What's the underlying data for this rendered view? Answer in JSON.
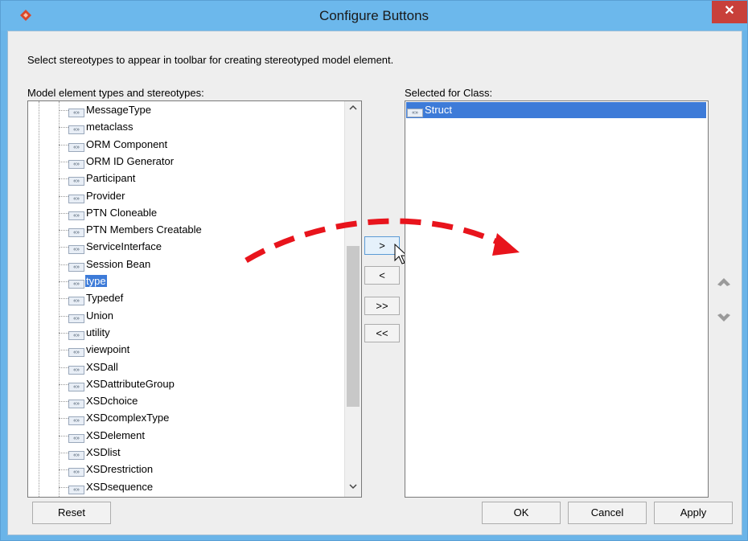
{
  "window": {
    "title": "Configure Buttons",
    "close_symbol": "✕"
  },
  "instructions": "Select stereotypes to appear in toolbar for creating stereotyped model element.",
  "left_panel": {
    "label": "Model element types and stereotypes:",
    "icon_text": "«»",
    "items": [
      {
        "label": "MessageType",
        "selected": false
      },
      {
        "label": "metaclass",
        "selected": false
      },
      {
        "label": "ORM Component",
        "selected": false
      },
      {
        "label": "ORM ID Generator",
        "selected": false
      },
      {
        "label": "Participant",
        "selected": false
      },
      {
        "label": "Provider",
        "selected": false
      },
      {
        "label": "PTN Cloneable",
        "selected": false
      },
      {
        "label": "PTN Members Creatable",
        "selected": false
      },
      {
        "label": "ServiceInterface",
        "selected": false
      },
      {
        "label": "Session Bean",
        "selected": false
      },
      {
        "label": "type",
        "selected": true
      },
      {
        "label": "Typedef",
        "selected": false
      },
      {
        "label": "Union",
        "selected": false
      },
      {
        "label": "utility",
        "selected": false
      },
      {
        "label": "viewpoint",
        "selected": false
      },
      {
        "label": "XSDall",
        "selected": false
      },
      {
        "label": "XSDattributeGroup",
        "selected": false
      },
      {
        "label": "XSDchoice",
        "selected": false
      },
      {
        "label": "XSDcomplexType",
        "selected": false
      },
      {
        "label": "XSDelement",
        "selected": false
      },
      {
        "label": "XSDlist",
        "selected": false
      },
      {
        "label": "XSDrestriction",
        "selected": false
      },
      {
        "label": "XSDsequence",
        "selected": false
      }
    ],
    "scroll_up": "^",
    "scroll_down": "v"
  },
  "middle_buttons": {
    "add": ">",
    "remove": "<",
    "add_all": ">>",
    "remove_all": "<<"
  },
  "right_panel": {
    "label": "Selected for Class:",
    "items": [
      {
        "label": "Struct"
      }
    ]
  },
  "footer": {
    "reset": "Reset",
    "ok": "OK",
    "cancel": "Cancel",
    "apply": "Apply"
  },
  "colors": {
    "title_bar": "#6cb8ec",
    "close_button": "#c8403a",
    "selection": "#3d7bd8",
    "annotation_arrow": "#e8141c",
    "app_icon": "#d9472b"
  }
}
